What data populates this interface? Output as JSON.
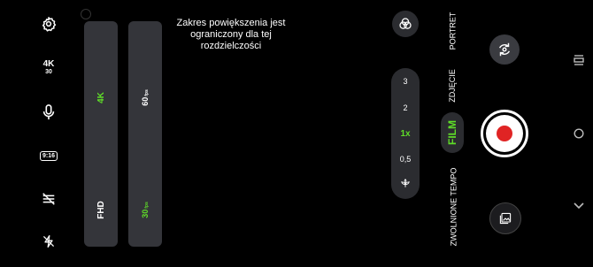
{
  "left_settings": {
    "items": [
      {
        "name": "settings-icon"
      },
      {
        "name": "resolution-badge",
        "main": "4K",
        "sub": "30"
      },
      {
        "name": "microphone-icon"
      },
      {
        "name": "aspect-ratio-badge",
        "label": "9:16"
      },
      {
        "name": "stabilization-off-icon"
      },
      {
        "name": "flash-off-icon"
      }
    ]
  },
  "resolution_selector": {
    "options": [
      {
        "label": "4K",
        "selected": true
      },
      {
        "label": "FHD",
        "selected": false
      }
    ]
  },
  "fps_selector": {
    "options": [
      {
        "value": "60",
        "unit": "fps",
        "selected": false
      },
      {
        "value": "30",
        "unit": "fps",
        "selected": true
      }
    ]
  },
  "zoom_limit_message": "Zakres powiększenia jest ograniczony dla tej rozdzielczości",
  "zoom": {
    "levels": [
      "3",
      "2",
      "1x",
      "0,5"
    ],
    "selected": "1x"
  },
  "modes": [
    {
      "label": "PORTRET",
      "selected": false
    },
    {
      "label": "ZDJĘCIE",
      "selected": false
    },
    {
      "label": "FILM",
      "selected": true
    },
    {
      "label": "ZWOLNIONE TEMPO",
      "selected": false
    }
  ],
  "colors": {
    "accent": "#5fdc28",
    "record": "#e02424",
    "panel": "#34353a"
  }
}
